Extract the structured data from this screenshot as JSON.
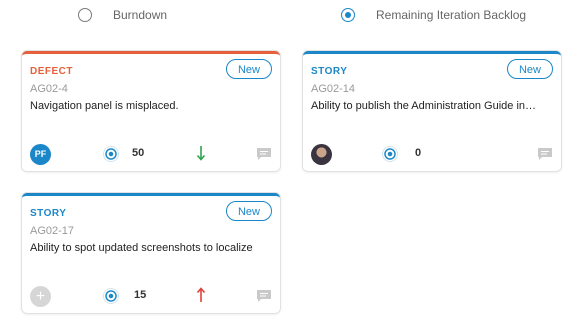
{
  "view_options": [
    {
      "label": "Burndown",
      "selected": false
    },
    {
      "label": "Remaining Iteration Backlog",
      "selected": true
    }
  ],
  "cards": [
    {
      "type": "DEFECT",
      "badge": "New",
      "id": "AG02-4",
      "title": "Navigation panel is misplaced.",
      "owner": {
        "kind": "initials",
        "text": "PF"
      },
      "estimate": "50",
      "trend": "down",
      "comment_icon": "comment-icon"
    },
    {
      "type": "STORY",
      "badge": "New",
      "id": "AG02-14",
      "title": "Ability to publish the Administration Guide in…",
      "owner": {
        "kind": "photo",
        "text": ""
      },
      "estimate": "0",
      "trend": "none",
      "comment_icon": "comment-icon"
    },
    {
      "type": "STORY",
      "badge": "New",
      "id": "AG02-17",
      "title": "Ability to spot updated screenshots to localize",
      "owner": {
        "kind": "add",
        "text": "+"
      },
      "estimate": "15",
      "trend": "up",
      "comment_icon": "comment-icon"
    }
  ],
  "colors": {
    "defect": "#e5603b",
    "story": "#1b87c8",
    "trend_down": "#2ea44f",
    "trend_up": "#e0413c"
  }
}
